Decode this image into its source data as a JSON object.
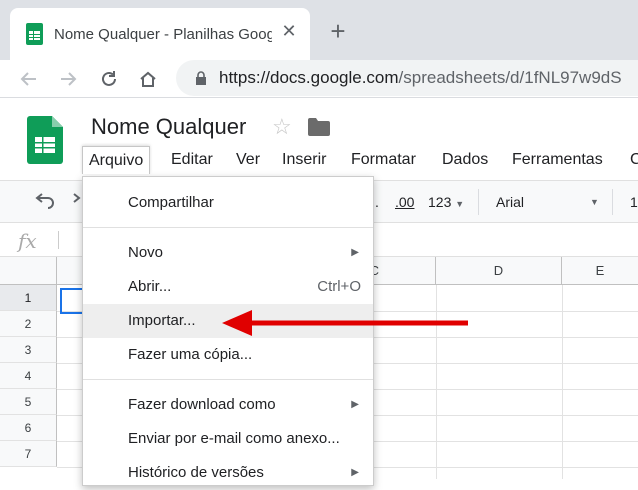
{
  "browser": {
    "tab_title": "Nome Qualquer - Planilhas Goog",
    "url_host": "https://docs.google.com",
    "url_path": "/spreadsheets/d/1fNL97w9dS",
    "accent": "#0f9d58"
  },
  "doc": {
    "title": "Nome Qualquer"
  },
  "menu": [
    "Arquivo",
    "Editar",
    "Ver",
    "Inserir",
    "Formatar",
    "Dados",
    "Ferramentas",
    "C"
  ],
  "toolbar": {
    "decimal": ".00",
    "format": "123",
    "font": "Arial",
    "size": "1"
  },
  "formula": {
    "fx": "fx"
  },
  "grid": {
    "columns": [
      "C",
      "D",
      "E"
    ],
    "rows": [
      "1",
      "2",
      "3",
      "4",
      "5",
      "6",
      "7"
    ]
  },
  "file_menu": {
    "share": "Compartilhar",
    "new": "Novo",
    "open": "Abrir...",
    "open_shortcut": "Ctrl+O",
    "import": "Importar...",
    "copy": "Fazer uma cópia...",
    "download": "Fazer download como",
    "email": "Enviar por e-mail como anexo...",
    "history": "Histórico de versões"
  },
  "annotation_color": "#e00000"
}
